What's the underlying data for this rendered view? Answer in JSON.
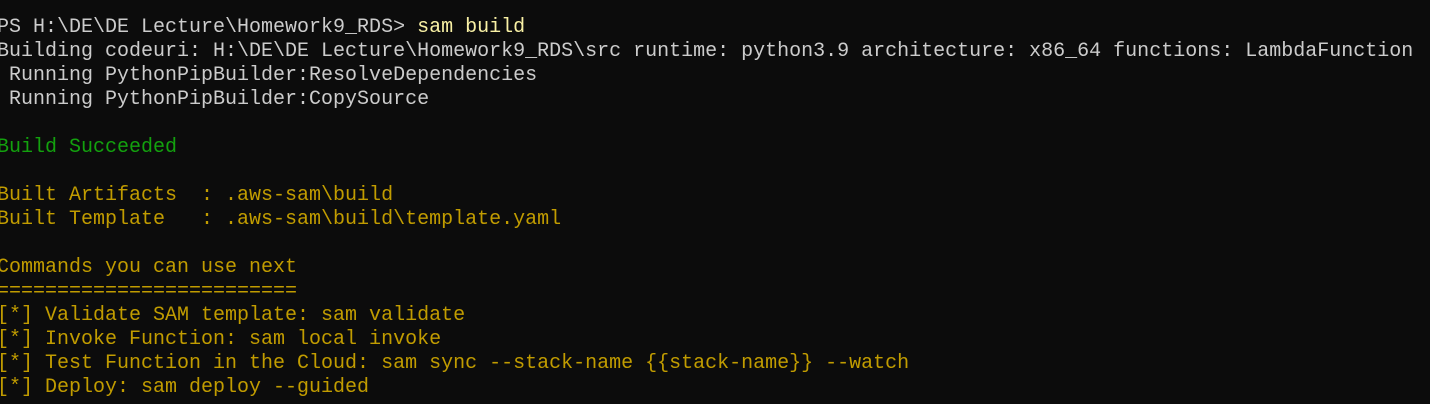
{
  "prompt": "PS H:\\DE\\DE Lecture\\Homework9_RDS> ",
  "command": "sam build",
  "output": [
    "Building codeuri: H:\\DE\\DE Lecture\\Homework9_RDS\\src runtime: python3.9 architecture: x86_64 functions: LambdaFunction",
    " Running PythonPipBuilder:ResolveDependencies",
    " Running PythonPipBuilder:CopySource"
  ],
  "status": "Build Succeeded",
  "artifacts": [
    "Built Artifacts  : .aws-sam\\build",
    "Built Template   : .aws-sam\\build\\template.yaml"
  ],
  "next_header": "Commands you can use next",
  "separator": "=========================",
  "next_commands": [
    "[*] Validate SAM template: sam validate",
    "[*] Invoke Function: sam local invoke",
    "[*] Test Function in the Cloud: sam sync --stack-name {{stack-name}} --watch",
    "[*] Deploy: sam deploy --guided"
  ],
  "colors": {
    "background": "#0c0c0c",
    "text": "#cccccc",
    "command": "#f9f1a5",
    "success": "#13a10e",
    "hint": "#c19c00"
  }
}
